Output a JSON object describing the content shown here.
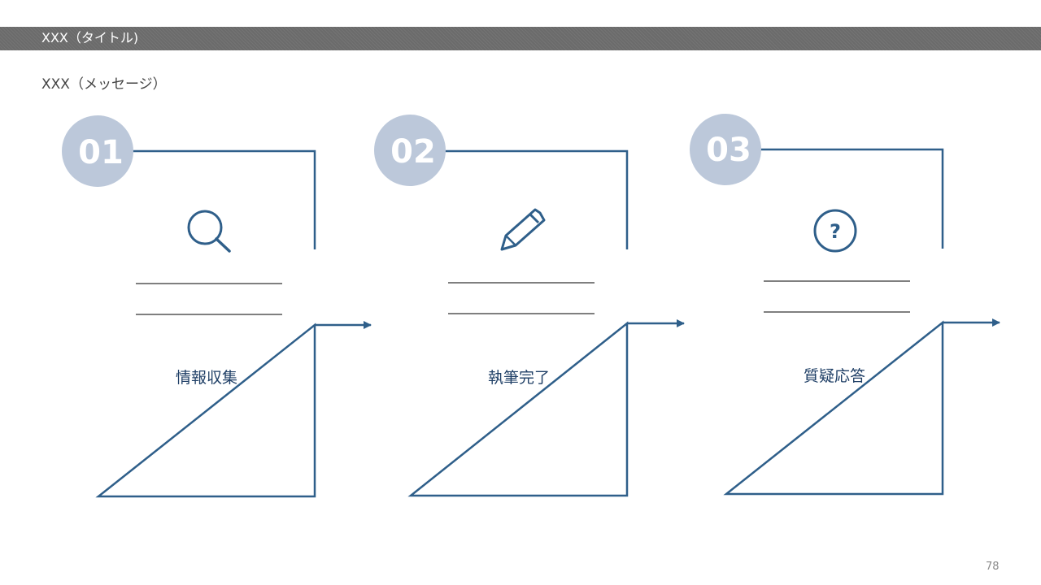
{
  "header": {
    "title": "XXX（タイトル)"
  },
  "message": "XXX（メッセージ）",
  "steps": [
    {
      "number": "01",
      "label": "情報収集",
      "icon": "search-icon"
    },
    {
      "number": "02",
      "label": "執筆完了",
      "icon": "pencil-icon"
    },
    {
      "number": "03",
      "label": "質疑応答",
      "icon": "question-icon"
    }
  ],
  "page_number": "78",
  "colors": {
    "frame": "#2f5f8a",
    "number_circle": "#bcc8da",
    "title_bar": "#6b6b6b",
    "label_text": "#1f3f66",
    "divider": "#333333"
  }
}
